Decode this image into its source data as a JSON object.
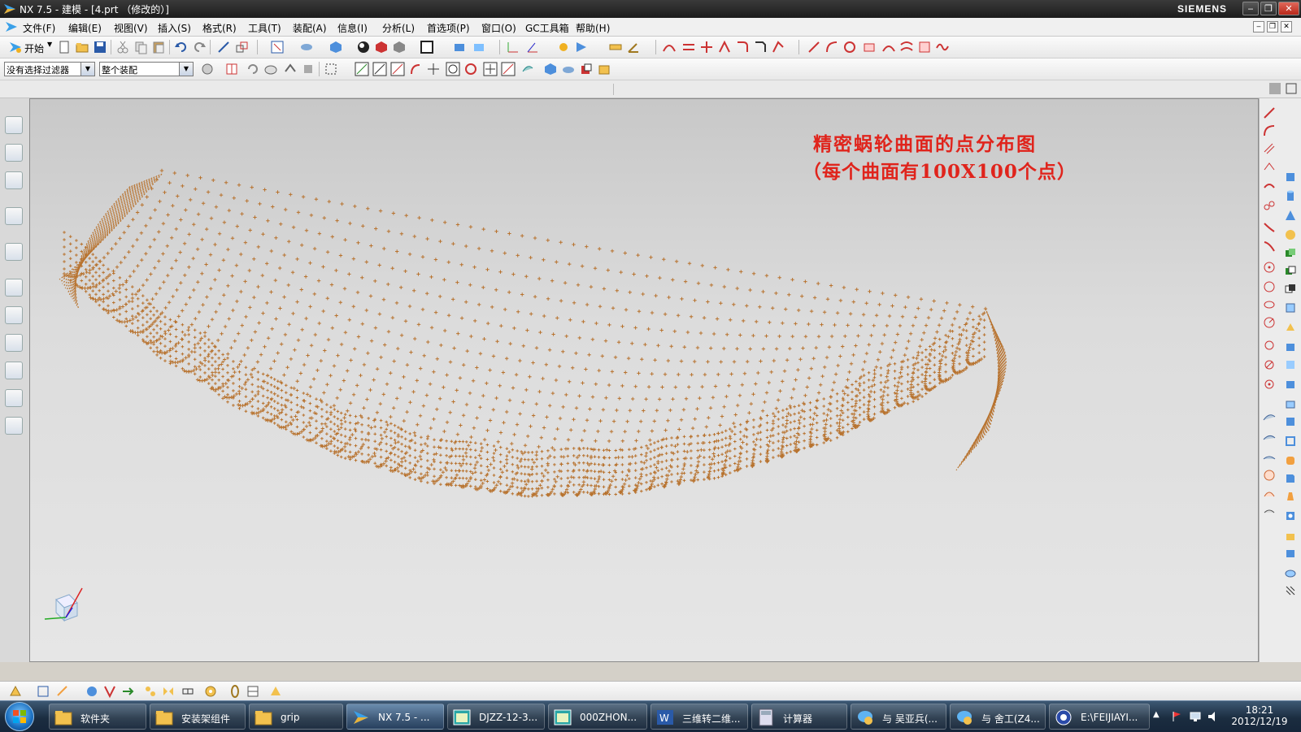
{
  "window": {
    "title": "NX 7.5 - 建模 - [4.prt （修改的）]",
    "brand": "SIEMENS"
  },
  "menu": [
    "文件(F)",
    "编辑(E)",
    "视图(V)",
    "插入(S)",
    "格式(R)",
    "工具(T)",
    "装配(A)",
    "信息(I)",
    "分析(L)",
    "首选项(P)",
    "窗口(O)",
    "GC工具箱",
    "帮助(H)"
  ],
  "toolbar": {
    "start_label": "开始"
  },
  "selection": {
    "filter": "没有选择过滤器",
    "scope": "整个装配"
  },
  "viewport": {
    "annotation_title": "精密蜗轮曲面的点分布图",
    "annotation_sub": "（每个曲面有100X100个点）",
    "point_color": "#b8732f"
  },
  "taskbar": {
    "items": [
      {
        "label": "软件夹",
        "icon": "folder-icon"
      },
      {
        "label": "安装架组件",
        "icon": "folder-icon"
      },
      {
        "label": "grip",
        "icon": "folder-icon"
      },
      {
        "label": "NX 7.5 - ...",
        "icon": "nx-icon"
      },
      {
        "label": "DJZZ-12-3...",
        "icon": "window-icon"
      },
      {
        "label": "000ZHON...",
        "icon": "window-icon"
      },
      {
        "label": "三维转二维...",
        "icon": "word-icon"
      },
      {
        "label": "计算器",
        "icon": "calculator-icon"
      },
      {
        "label": "与 吴亚兵(...",
        "icon": "chat-icon"
      },
      {
        "label": "与 舍工(Z4...",
        "icon": "chat-icon"
      },
      {
        "label": "E:\\FEIJIAYI...",
        "icon": "app-icon"
      }
    ],
    "time": "18:21",
    "date": "2012/12/19"
  }
}
